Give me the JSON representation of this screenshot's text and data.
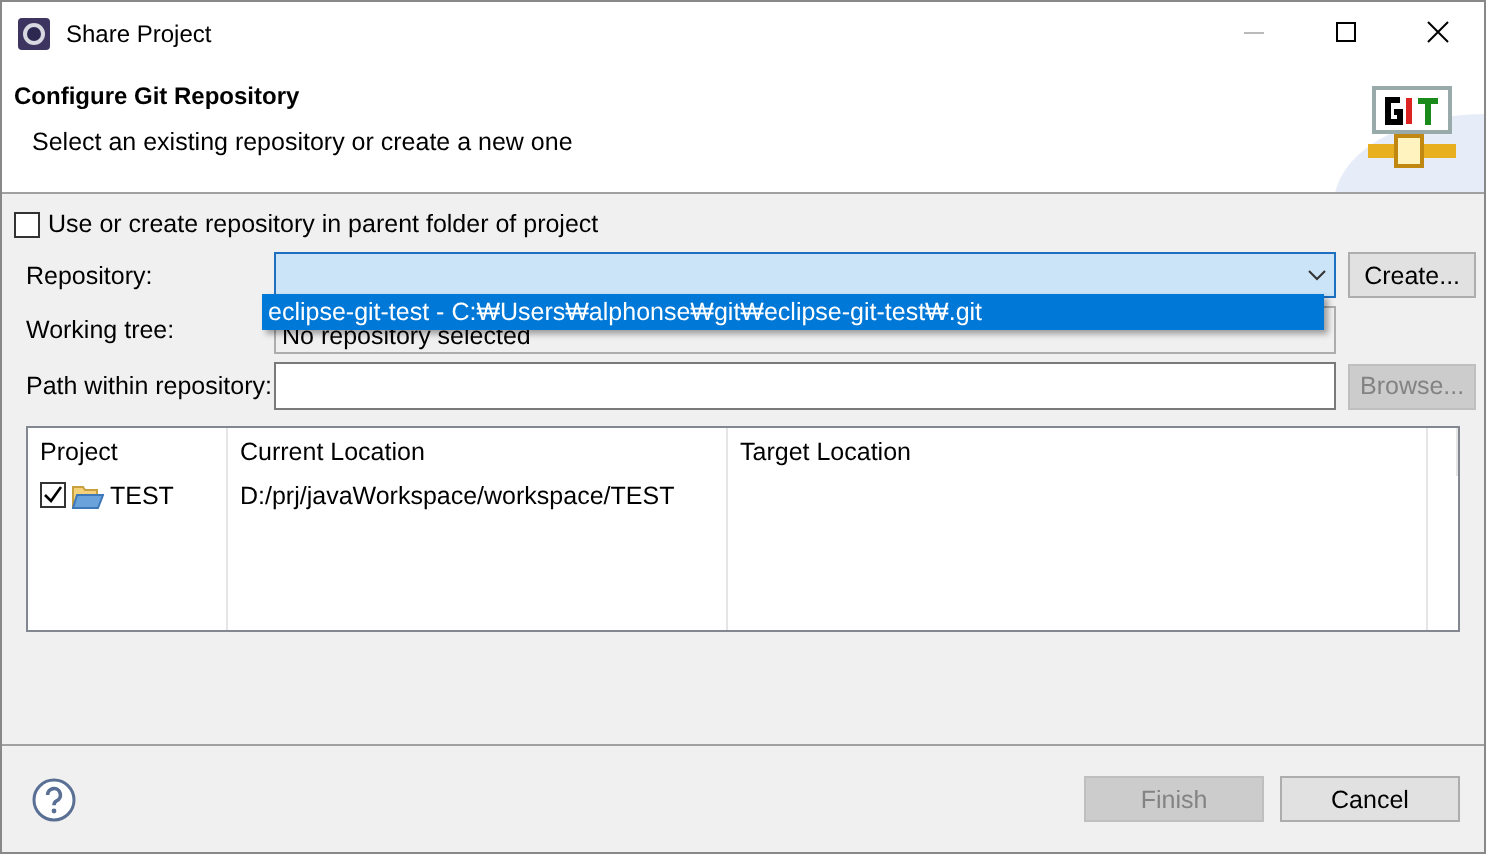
{
  "window": {
    "title": "Share Project"
  },
  "header": {
    "title": "Configure Git Repository",
    "description": "Select an existing repository or create a new one"
  },
  "parent_folder_option": {
    "label": "Use or create repository in parent folder of project",
    "checked": false
  },
  "repository": {
    "label": "Repository:",
    "button": {
      "label": "Create...",
      "disabled": false
    },
    "dropdown": [
      {
        "label": "eclipse-git-test - C:₩Users₩alphonse₩git₩eclipse-git-test₩.git",
        "selected": true
      }
    ]
  },
  "working_tree": {
    "label": "Working tree:",
    "value": "No repository selected"
  },
  "path_within_repository": {
    "label": "Path within repository:",
    "button": {
      "label": "Browse...",
      "disabled": true
    }
  },
  "table": {
    "columns": [
      "Project",
      "Current Location",
      "Target Location"
    ],
    "rows": [
      {
        "checked": true,
        "project": "TEST",
        "current_location": "D:/prj/javaWorkspace/workspace/TEST"
      }
    ]
  },
  "buttons": [
    {
      "label": "Finish",
      "disabled": true
    },
    {
      "label": "Cancel",
      "disabled": false
    }
  ]
}
